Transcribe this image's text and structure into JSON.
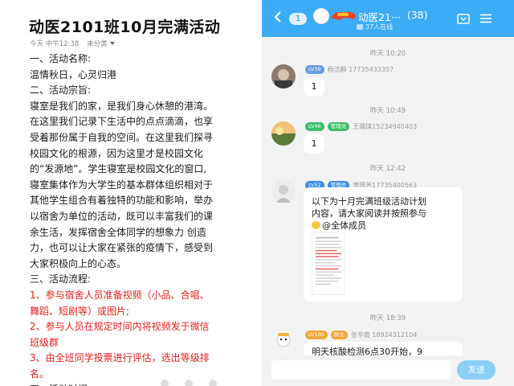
{
  "note": {
    "title": "动医2101班10月完满活动",
    "time": "今天 中午12:38",
    "category": "未分类",
    "lines": [
      {
        "text": "一、活动名称:",
        "red": false
      },
      {
        "text": "温情秋日，心灵归港",
        "red": false
      },
      {
        "text": "二、活动宗旨:",
        "red": false
      },
      {
        "text": "寝室是我们的家，是我们身心休憩的港湾。",
        "red": false
      },
      {
        "text": "在这里我们记录下生活中的点点滴滴，也享",
        "red": false
      },
      {
        "text": "受着那份属于自我的空间。在这里我们探寻",
        "red": false
      },
      {
        "text": "校园文化的根源，因为这里才是校园文化",
        "red": false
      },
      {
        "text": "的“发源地”。学生寝室是校园文化的窗口,",
        "red": false
      },
      {
        "text": "寝室集体作为大学生的基本群体组织相对于",
        "red": false
      },
      {
        "text": "其他学生组合有着独特的功能和影响，举办",
        "red": false
      },
      {
        "text": "以宿舍为单位的活动，既可以丰富我们的课",
        "red": false
      },
      {
        "text": "余生活，发挥宿舍全体同学的想象力 创造",
        "red": false
      },
      {
        "text": "力，也可以让大家在紧张的疫情下，感受到",
        "red": false
      },
      {
        "text": "大家积极向上的心态。",
        "red": false
      },
      {
        "text": "三、活动流程:",
        "red": false
      },
      {
        "text": "1、参与宿舍人员准备视频（小品、合唱、",
        "red": true
      },
      {
        "text": "舞蹈、短剧等）或图片;",
        "red": true
      },
      {
        "text": "2、参与人员在规定时间内将视频发于微信",
        "red": true
      },
      {
        "text": "班级群",
        "red": true
      },
      {
        "text": "3、由全班同学投票进行评估，选出等级排",
        "red": true
      },
      {
        "text": "名。",
        "red": true
      },
      {
        "text": "四、活动时间",
        "red": false
      }
    ]
  },
  "chat": {
    "header": {
      "unread": "1",
      "group_name": "动医21···",
      "member_count": "(38)",
      "online": "37人在线"
    },
    "messages": [
      {
        "time": "昨天 10:20",
        "level": "LV39",
        "sender": "杨洁颖 17735433357",
        "text": "1"
      },
      {
        "time": "昨天 10:49",
        "level": "LV46",
        "role": "管理员",
        "sender": "王璐琪15234940403",
        "text": "1"
      },
      {
        "time": "昨天 12:42",
        "level": "LV52",
        "role": "管理员",
        "sender": "李国芳17735400563",
        "lines": [
          "以下为十月完满班级活动计划",
          "内容，请大家阅读并按照参与",
          "@全体成员"
        ]
      },
      {
        "time": "昨天 18:39",
        "level": "LV100",
        "role": "群主",
        "sender": "张辛南 18924312104",
        "text": "明天核酸检测6点30开始，9"
      }
    ],
    "input_placeholder": "",
    "send_label": "发送"
  },
  "colors": {
    "header_blue": "#3dacf7",
    "red_text": "#e02020",
    "chat_bg": "#f1f2f4"
  }
}
